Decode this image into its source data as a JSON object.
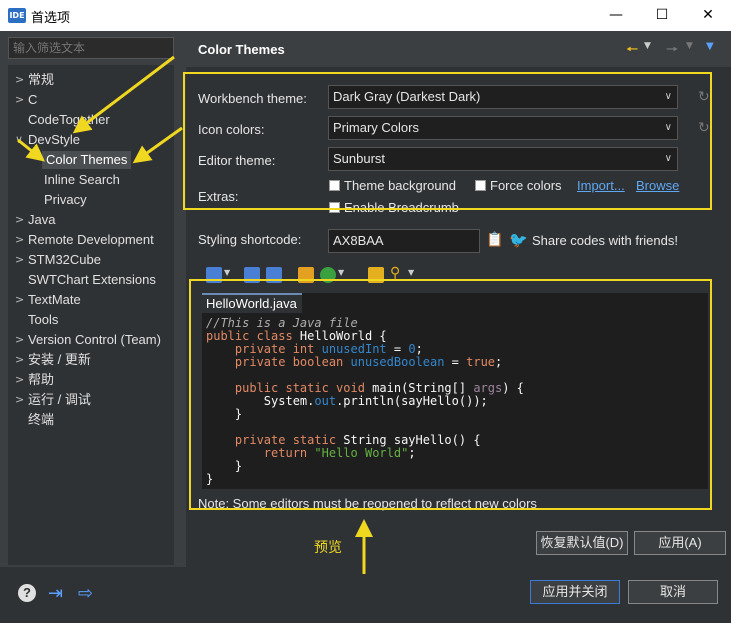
{
  "window": {
    "title": "首选项",
    "app_badge": "IDE"
  },
  "sidebar": {
    "filter_placeholder": "输入筛选文本",
    "items": [
      {
        "label": "常规",
        "expandable": true
      },
      {
        "label": "C",
        "expandable": true
      },
      {
        "label": "CodeTogether",
        "expandable": false
      },
      {
        "label": "DevStyle",
        "expandable": true,
        "expanded": true
      },
      {
        "label": "Color Themes",
        "expandable": false,
        "selected": true
      },
      {
        "label": "Inline Search",
        "expandable": false
      },
      {
        "label": "Privacy",
        "expandable": false
      },
      {
        "label": "Java",
        "expandable": true
      },
      {
        "label": "Remote Development",
        "expandable": true
      },
      {
        "label": "STM32Cube",
        "expandable": true
      },
      {
        "label": "SWTChart Extensions",
        "expandable": false
      },
      {
        "label": "TextMate",
        "expandable": true
      },
      {
        "label": "Tools",
        "expandable": false
      },
      {
        "label": "Version Control (Team)",
        "expandable": true
      },
      {
        "label": "安装 / 更新",
        "expandable": true
      },
      {
        "label": "帮助",
        "expandable": true
      },
      {
        "label": "运行 / 调试",
        "expandable": true
      },
      {
        "label": "终端",
        "expandable": false
      }
    ]
  },
  "main": {
    "title": "Color Themes",
    "workbench_label": "Workbench theme:",
    "workbench_value": "Dark Gray (Darkest Dark)",
    "icon_colors_label": "Icon colors:",
    "icon_colors_value": "Primary Colors",
    "editor_theme_label": "Editor theme:",
    "editor_theme_value": "Sunburst",
    "extras_label": "Extras:",
    "theme_background": "Theme background",
    "force_colors": "Force colors",
    "import_link": "Import...",
    "browse_link": "Browse",
    "enable_breadcrumb": "Enable Breadcrumb",
    "shortcut_label": "Styling shortcode:",
    "shortcut_value": "AX8BAA",
    "share_text": "Share codes with friends!",
    "editor_tab": "HelloWorld.java",
    "note": "Note: Some editors must be reopened to reflect new colors"
  },
  "buttons": {
    "restore_defaults": "恢复默认值(D)",
    "apply": "应用(A)",
    "apply_close": "应用并关闭",
    "cancel": "取消"
  },
  "annotation": {
    "preview_label": "预览"
  },
  "colors": {
    "highlight": "#f0d820",
    "link": "#5fa8f2",
    "accent": "#2b6fc2"
  }
}
